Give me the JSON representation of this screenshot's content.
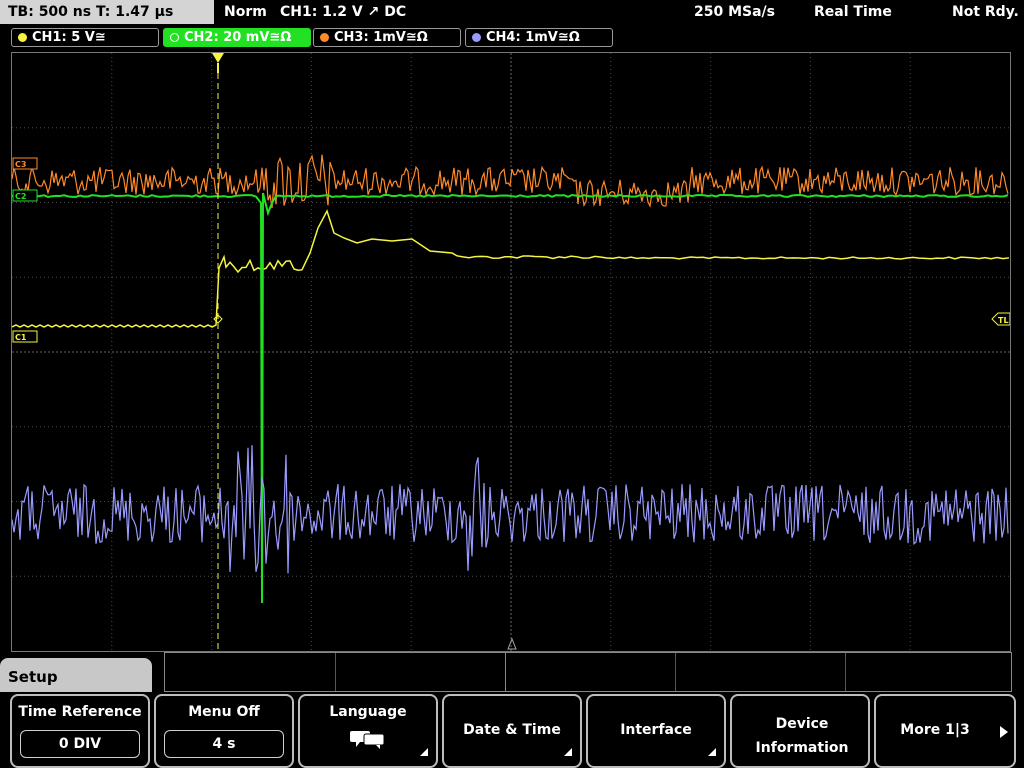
{
  "status": {
    "timebase": "TB: 500 ns  T: 1.47 µs",
    "mode": "Norm",
    "trigger": "CH1: 1.2 V ↗ DC",
    "sample_rate": "250 MSa/s",
    "acquisition": "Real Time",
    "state": "Not Rdy."
  },
  "channels": [
    {
      "label": "CH1: 5 V≅",
      "color": "#f5f542",
      "active": false
    },
    {
      "label": "CH2: 20 mV≅Ω",
      "color": "#22e022",
      "active": true
    },
    {
      "label": "CH3: 1mV≅Ω",
      "color": "#ff8a2a",
      "active": false
    },
    {
      "label": "CH4: 1mV≅Ω",
      "color": "#9a9aff",
      "active": false
    }
  ],
  "markers": {
    "c3": "C3",
    "c2": "C2",
    "c1": "C1",
    "tl": "TL"
  },
  "menu": {
    "title": "Setup",
    "softkeys": [
      {
        "title": "Time Reference",
        "value": "0 DIV"
      },
      {
        "title": "Menu Off",
        "value": "4 s"
      },
      {
        "title": "Language",
        "icon": "speech-bubble-icon"
      },
      {
        "title": "Date & Time"
      },
      {
        "title": "Interface"
      },
      {
        "title": "Device Information"
      },
      {
        "title": "More 1|3",
        "icon": "arrow-right-icon"
      }
    ]
  },
  "colors": {
    "ch1": "#f5f542",
    "ch2": "#22e022",
    "ch3": "#ff8a2a",
    "ch4": "#9a9aff",
    "grid": "#4a4a4a"
  }
}
